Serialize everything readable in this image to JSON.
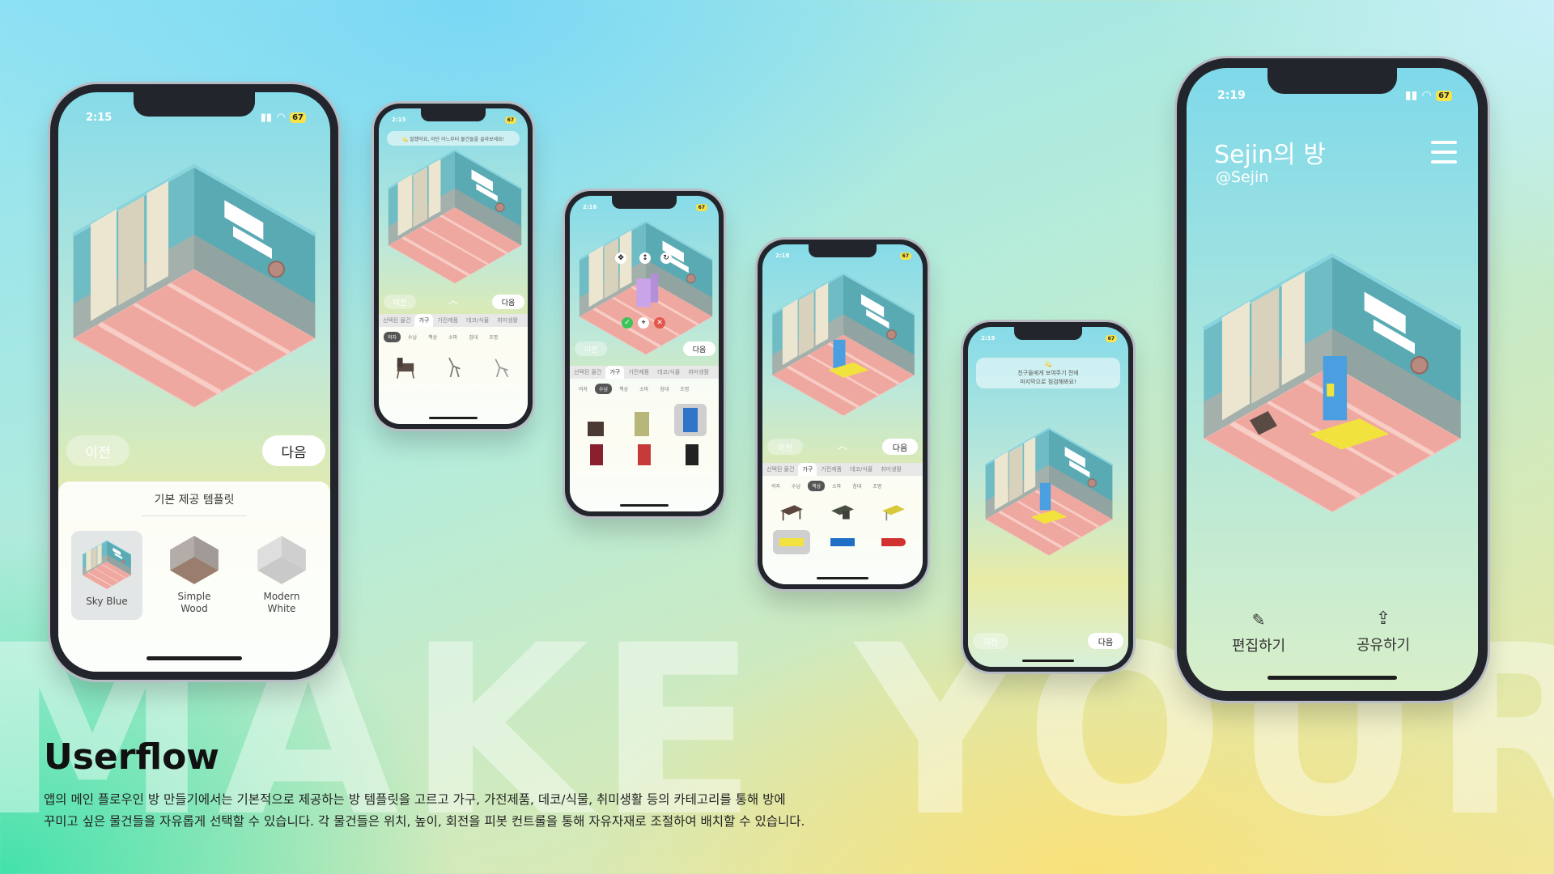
{
  "background_word": "MAKE YOUR R",
  "caption": {
    "title": "Userflow",
    "line1": "앱의 메인 플로우인 방 만들기에서는 기본적으로 제공하는 방 템플릿을 고르고 가구, 가전제품, 데코/식물, 취미생활 등의 카테고리를 통해 방에",
    "line2": "꾸미고 싶은 물건들을 자유롭게 선택할 수 있습니다. 각 물건들은 위치, 높이, 회전을 피봇 컨트롤을 통해 자유자재로 조절하여 배치할 수 있습니다."
  },
  "colors": {
    "wall": "#6fbcc5",
    "floor": "#efa8a0",
    "curtain": "#ece6d0",
    "accent_yellow": "#f2e23e",
    "shelf_blue": "#4a9fe0"
  },
  "phone1": {
    "time": "2:15",
    "battery": "67",
    "prev": "이전",
    "next": "다음",
    "panel_title": "기본 제공 템플릿",
    "templates": [
      {
        "line1": "Sky Blue",
        "line2": ""
      },
      {
        "line1": "Simple",
        "line2": "Wood"
      },
      {
        "line1": "Modern",
        "line2": "White"
      }
    ]
  },
  "phone2": {
    "time": "2:15",
    "toast": "💫 잘했어요, 이단 아느부터 물건들을 골라보세요!",
    "prev": "이전",
    "next": "다음",
    "tabs": [
      "선택된 물건",
      "가구",
      "가전제품",
      "데코/식물",
      "취미생활"
    ],
    "subtabs": [
      "의자",
      "수납",
      "책상",
      "소파",
      "침대",
      "조명"
    ]
  },
  "phone3": {
    "time": "2:16",
    "prev": "이전",
    "next": "다음",
    "tabs": [
      "선택된 물건",
      "가구",
      "가전제품",
      "데코/식물",
      "취미생활"
    ],
    "subtabs": [
      "의자",
      "수납",
      "책상",
      "소파",
      "침대",
      "조명"
    ]
  },
  "phone4": {
    "time": "2:18",
    "prev": "이전",
    "next": "다음",
    "tabs": [
      "선택된 물건",
      "가구",
      "가전제품",
      "데코/식물",
      "취미생활"
    ],
    "subtabs": [
      "의자",
      "수납",
      "책상",
      "소파",
      "침대",
      "조명"
    ]
  },
  "phone5": {
    "time": "2:19",
    "toast_line1": "친구들에게 보여주기 전에",
    "toast_line2": "마지막으로 점검해봐요!",
    "prev": "이전",
    "next": "다음"
  },
  "phone6": {
    "time": "2:19",
    "battery": "67",
    "room_title": "Sejin의 방",
    "handle": "@Sejin",
    "edit_label": "편집하기",
    "share_label": "공유하기"
  }
}
